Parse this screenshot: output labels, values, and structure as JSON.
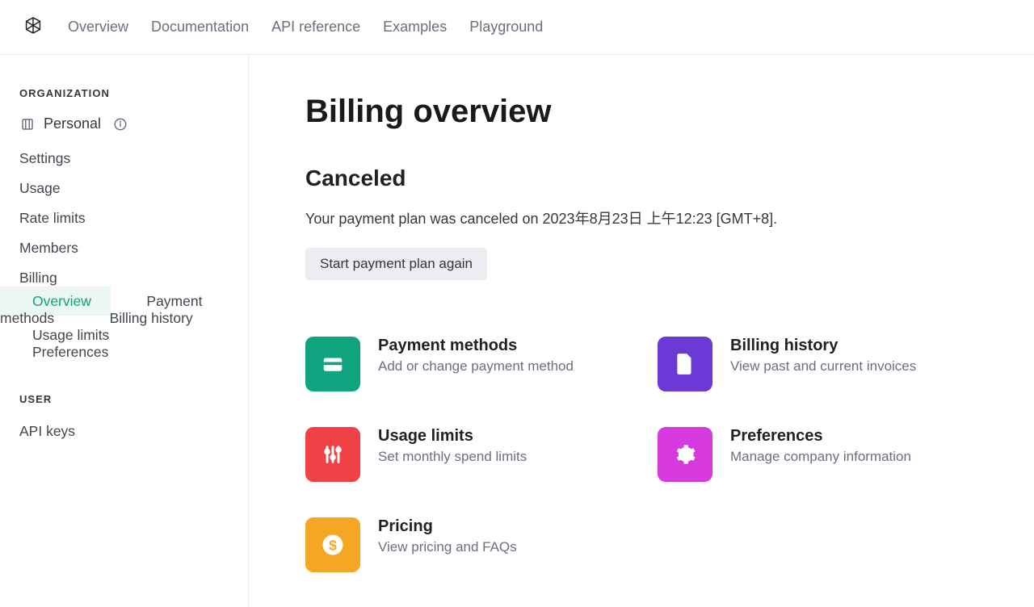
{
  "nav": {
    "items": [
      "Overview",
      "Documentation",
      "API reference",
      "Examples",
      "Playground"
    ]
  },
  "sidebar": {
    "section_org": "ORGANIZATION",
    "org_name": "Personal",
    "items": [
      "Settings",
      "Usage",
      "Rate limits",
      "Members",
      "Billing"
    ],
    "billing_sub": [
      "Overview",
      "Payment methods",
      "Billing history",
      "Usage limits",
      "Preferences"
    ],
    "section_user": "USER",
    "user_items": [
      "API keys"
    ]
  },
  "main": {
    "title": "Billing overview",
    "status_title": "Canceled",
    "status_desc": "Your payment plan was canceled on 2023年8月23日 上午12:23 [GMT+8].",
    "cta": "Start payment plan again",
    "cards": [
      {
        "title": "Payment methods",
        "desc": "Add or change payment method",
        "icon": "credit-card-icon",
        "color": "icon-green"
      },
      {
        "title": "Billing history",
        "desc": "View past and current invoices",
        "icon": "file-icon",
        "color": "icon-purple"
      },
      {
        "title": "Usage limits",
        "desc": "Set monthly spend limits",
        "icon": "sliders-icon",
        "color": "icon-red"
      },
      {
        "title": "Preferences",
        "desc": "Manage company information",
        "icon": "gear-icon",
        "color": "icon-pink"
      },
      {
        "title": "Pricing",
        "desc": "View pricing and FAQs",
        "icon": "dollar-icon",
        "color": "icon-orange"
      }
    ]
  }
}
